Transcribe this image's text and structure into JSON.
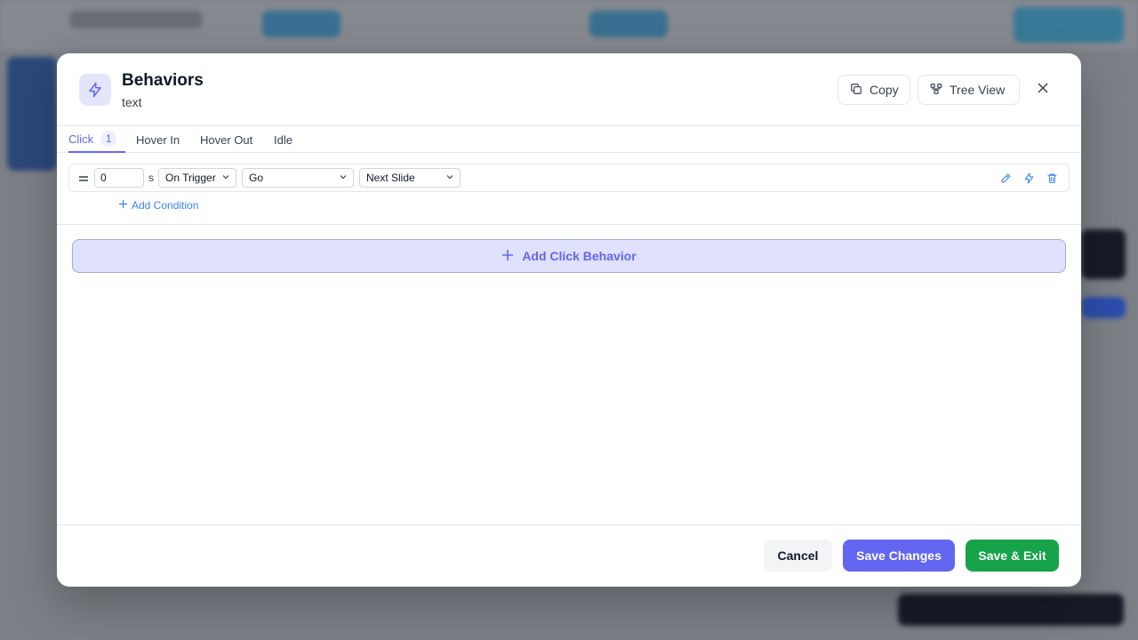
{
  "modal": {
    "title": "Behaviors",
    "subtitle": "text",
    "copy_label": "Copy",
    "tree_view_label": "Tree View"
  },
  "tabs": [
    {
      "label": "Click",
      "count": "1",
      "active": true
    },
    {
      "label": "Hover In"
    },
    {
      "label": "Hover Out"
    },
    {
      "label": "Idle"
    }
  ],
  "behavior": {
    "delay_value": "0",
    "delay_unit": "s",
    "trigger": "On Trigger",
    "action": "Go",
    "target": "Next Slide",
    "add_condition_label": "Add Condition"
  },
  "add_behavior_label": "Add Click Behavior",
  "footer": {
    "cancel_label": "Cancel",
    "save_label": "Save Changes",
    "save_exit_label": "Save & Exit"
  },
  "colors": {
    "accent": "#6366f1",
    "success": "#16a34a",
    "link": "#3b82f6"
  }
}
